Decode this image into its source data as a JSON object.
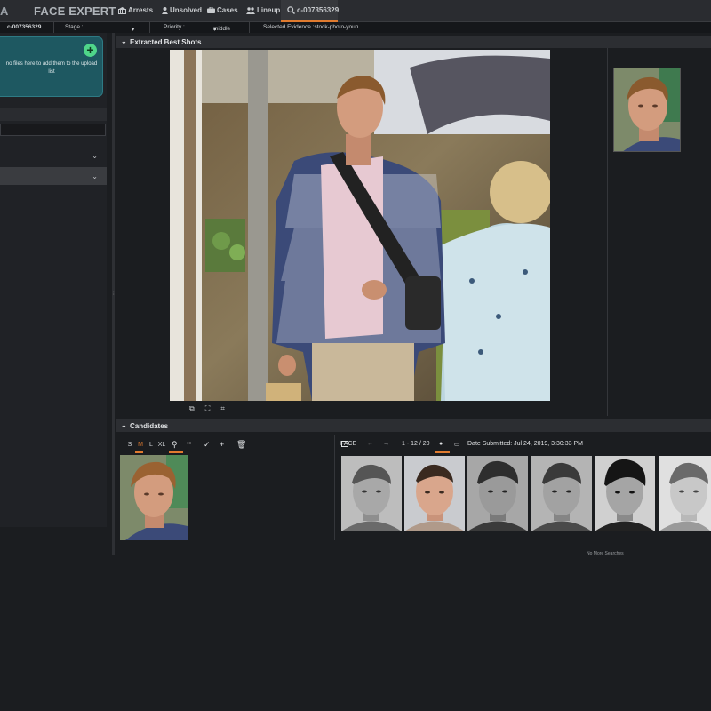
{
  "app": {
    "brand_prefix": "A",
    "brand": "FACE EXPERT"
  },
  "nav": {
    "arrests": "Arrests",
    "unsolved": "Unsolved",
    "cases": "Cases",
    "lineup": "Lineup",
    "case_tab": "c-007356329"
  },
  "infobar": {
    "case_id": "c-007356329",
    "stage_label": "Stage :",
    "stage_value": "",
    "priority_label": "Priority :",
    "priority_value": "middle",
    "evidence": "Selected Evidence :stock-photo-youn..."
  },
  "leftpanel": {
    "dropzone_text": "no files here to add them to the upload list"
  },
  "sections": {
    "best_shots": "Extracted Best Shots",
    "candidates": "Candidates"
  },
  "candidates": {
    "sizes": [
      "S",
      "M",
      "L",
      "XL"
    ],
    "active_size": "M",
    "tool_label": "FACE",
    "page_range": "1 - 12 / 20",
    "date_submitted": "Date Submitted: Jul 24, 2019, 3:30:33 PM",
    "no_more": "No More Searches"
  },
  "colors": {
    "accent": "#e07b2f",
    "dropzone": "#1e5861",
    "add_button": "#4fd68a"
  },
  "icons": {
    "arrests": "building-icon",
    "unsolved": "person-icon",
    "cases": "briefcase-icon",
    "lineup": "group-icon",
    "case_tab": "search-icon"
  }
}
